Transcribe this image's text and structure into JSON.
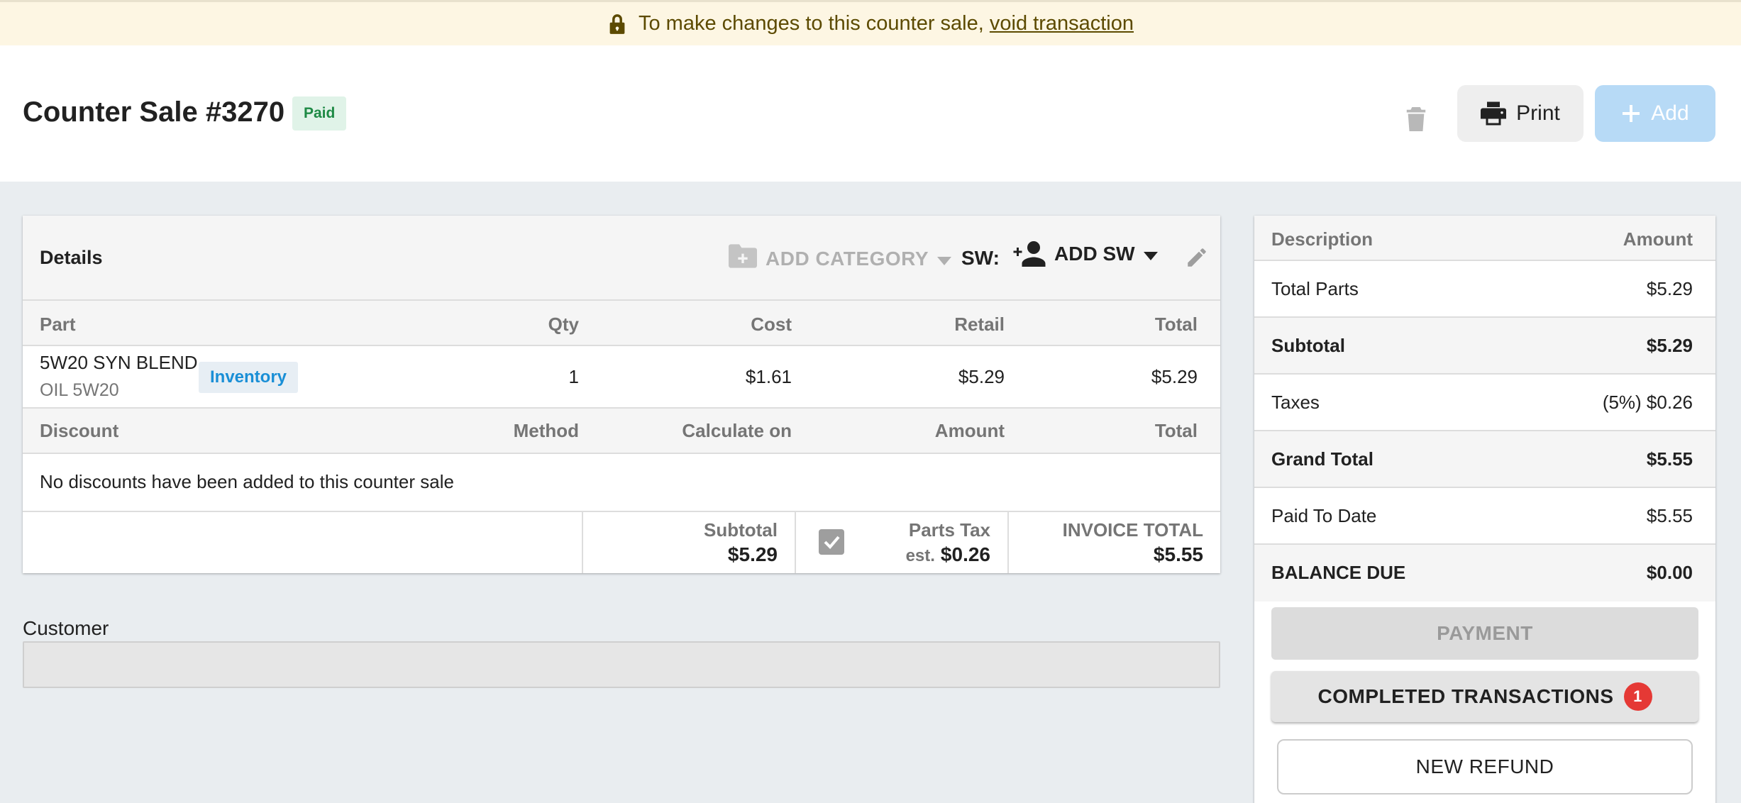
{
  "banner": {
    "message": "To make changes to this counter sale,",
    "link_label": "void transaction",
    "icon": "lock-icon"
  },
  "header": {
    "title": "Counter Sale #3270",
    "status": "Paid",
    "print_label": "Print",
    "add_label": "Add"
  },
  "details": {
    "title": "Details",
    "add_category_label": "ADD CATEGORY",
    "sw_label": "SW:",
    "add_sw_label": "ADD SW",
    "parts_columns": {
      "part": "Part",
      "qty": "Qty",
      "cost": "Cost",
      "retail": "Retail",
      "total": "Total"
    },
    "parts": [
      {
        "name": "5W20 SYN BLEND",
        "subtitle": "OIL 5W20",
        "tag": "Inventory",
        "qty": "1",
        "cost": "$1.61",
        "retail": "$5.29",
        "total": "$5.29"
      }
    ],
    "discount_columns": {
      "discount": "Discount",
      "method": "Method",
      "calculate_on": "Calculate on",
      "amount": "Amount",
      "total": "Total"
    },
    "discount_empty_message": "No discounts have been added to this counter sale",
    "totals": {
      "subtotal_label": "Subtotal",
      "subtotal_value": "$5.29",
      "parts_tax_label": "Parts Tax",
      "parts_tax_est": "est.",
      "parts_tax_value": "$0.26",
      "parts_tax_checked": true,
      "invoice_total_label": "INVOICE TOTAL",
      "invoice_total_value": "$5.55"
    }
  },
  "customer": {
    "label": "Customer",
    "value": ""
  },
  "summary": {
    "header": {
      "description": "Description",
      "amount": "Amount"
    },
    "rows": [
      {
        "label": "Total Parts",
        "value": "$5.29"
      },
      {
        "label": "Subtotal",
        "value": "$5.29"
      },
      {
        "label": "Taxes",
        "value": "(5%) $0.26"
      },
      {
        "label": "Grand Total",
        "value": "$5.55"
      },
      {
        "label": "Paid To Date",
        "value": "$5.55"
      },
      {
        "label": "BALANCE DUE",
        "value": "$0.00"
      }
    ],
    "payment_label": "PAYMENT",
    "completed_label": "COMPLETED TRANSACTIONS",
    "completed_count": "1",
    "refund_label": "NEW REFUND"
  },
  "colors": {
    "banner_bg": "#fdf6e3",
    "paid_badge": "#1e8a45",
    "inventory_tag": "#1a8fd6",
    "add_button": "#b7daf6",
    "count_badge": "#e53935"
  }
}
